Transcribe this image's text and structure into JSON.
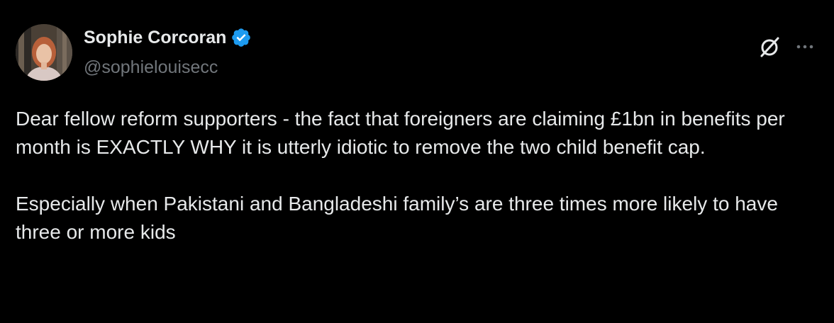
{
  "author": {
    "display_name": "Sophie Corcoran",
    "handle": "@sophielouisecc",
    "verified": true
  },
  "icons": {
    "verified": "verified-badge-icon",
    "grok": "grok-icon",
    "more": "more-options-icon"
  },
  "tweet": {
    "paragraphs": [
      "Dear fellow reform supporters - the fact that foreigners are claiming £1bn in benefits per month is EXACTLY WHY it is utterly idiotic to remove the two child benefit cap.",
      "Especially when Pakistani and Bangladeshi family’s are three times more likely to have three or more kids"
    ]
  },
  "colors": {
    "background": "#000000",
    "primary_text": "#e7e9ea",
    "secondary_text": "#71767b",
    "verified_blue": "#1d9bf0"
  }
}
